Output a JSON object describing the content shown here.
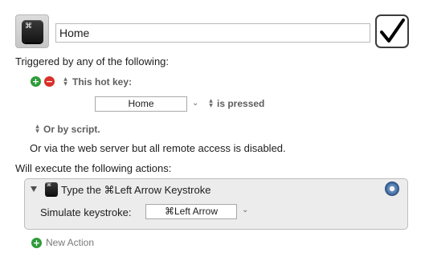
{
  "macro": {
    "name": "Home",
    "icon_name": "keyboard-key-icon",
    "enabled": true
  },
  "triggers": {
    "header": "Triggered by any of the following:",
    "hotkey_label": "This hot key:",
    "hotkey_value": "Home",
    "hotkey_condition": "is pressed",
    "script_label": "Or by script.",
    "web_server_note": "Or via the web server but all remote access is disabled."
  },
  "actions": {
    "header": "Will execute the following actions:",
    "items": [
      {
        "title": "Type the ⌘Left Arrow Keystroke",
        "param_label": "Simulate keystroke:",
        "param_value": "⌘Left Arrow"
      }
    ],
    "new_action_label": "New Action"
  },
  "colors": {
    "add": "#2e9b3a",
    "remove": "#d9302a",
    "gear": "#3f6598",
    "action_bg": "#ececec"
  }
}
